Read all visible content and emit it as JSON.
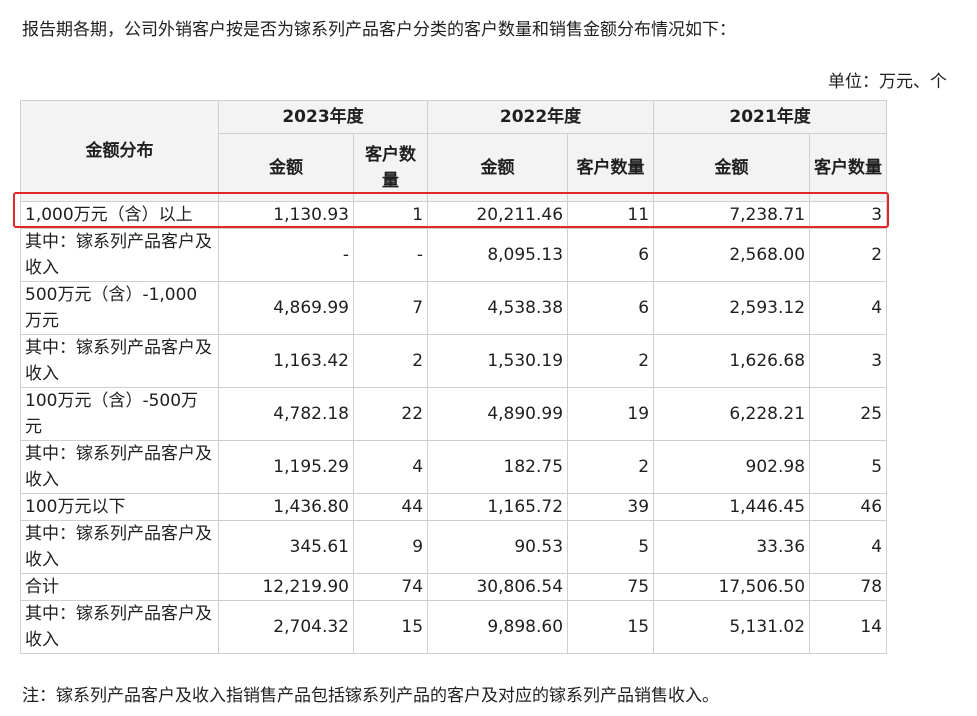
{
  "intro": "报告期各期，公司外销客户按是否为镓系列产品客户分类的客户数量和销售金额分布情况如下：",
  "unit": "单位：万元、个",
  "table": {
    "corner": "金额分布",
    "years": [
      "2023年度",
      "2022年度",
      "2021年度"
    ],
    "sub_amount": "金额",
    "sub_count_2023": "客户数量",
    "sub_count_2022": "客户数量",
    "sub_count_2021": "客户数量",
    "rows": [
      {
        "label": "1,000万元（含）以上",
        "v": [
          "1,130.93",
          "1",
          "20,211.46",
          "11",
          "7,238.71",
          "3"
        ]
      },
      {
        "label": "其中：镓系列产品客户及收入",
        "v": [
          "-",
          "-",
          "8,095.13",
          "6",
          "2,568.00",
          "2"
        ]
      },
      {
        "label": "500万元（含）-1,000万元",
        "v": [
          "4,869.99",
          "7",
          "4,538.38",
          "6",
          "2,593.12",
          "4"
        ]
      },
      {
        "label": "其中：镓系列产品客户及收入",
        "v": [
          "1,163.42",
          "2",
          "1,530.19",
          "2",
          "1,626.68",
          "3"
        ]
      },
      {
        "label": "100万元（含）-500万元",
        "v": [
          "4,782.18",
          "22",
          "4,890.99",
          "19",
          "6,228.21",
          "25"
        ]
      },
      {
        "label": "其中：镓系列产品客户及收入",
        "v": [
          "1,195.29",
          "4",
          "182.75",
          "2",
          "902.98",
          "5"
        ]
      },
      {
        "label": "100万元以下",
        "v": [
          "1,436.80",
          "44",
          "1,165.72",
          "39",
          "1,446.45",
          "46"
        ]
      },
      {
        "label": "其中：镓系列产品客户及收入",
        "v": [
          "345.61",
          "9",
          "90.53",
          "5",
          "33.36",
          "4"
        ]
      },
      {
        "label": "合计",
        "v": [
          "12,219.90",
          "74",
          "30,806.54",
          "75",
          "17,506.50",
          "78"
        ]
      },
      {
        "label": "其中：镓系列产品客户及收入",
        "v": [
          "2,704.32",
          "15",
          "9,898.60",
          "15",
          "5,131.02",
          "14"
        ]
      }
    ]
  },
  "highlight_color": "#e0272b",
  "note": "注：镓系列产品客户及收入指销售产品包括镓系列产品的客户及对应的镓系列产品销售收入。"
}
